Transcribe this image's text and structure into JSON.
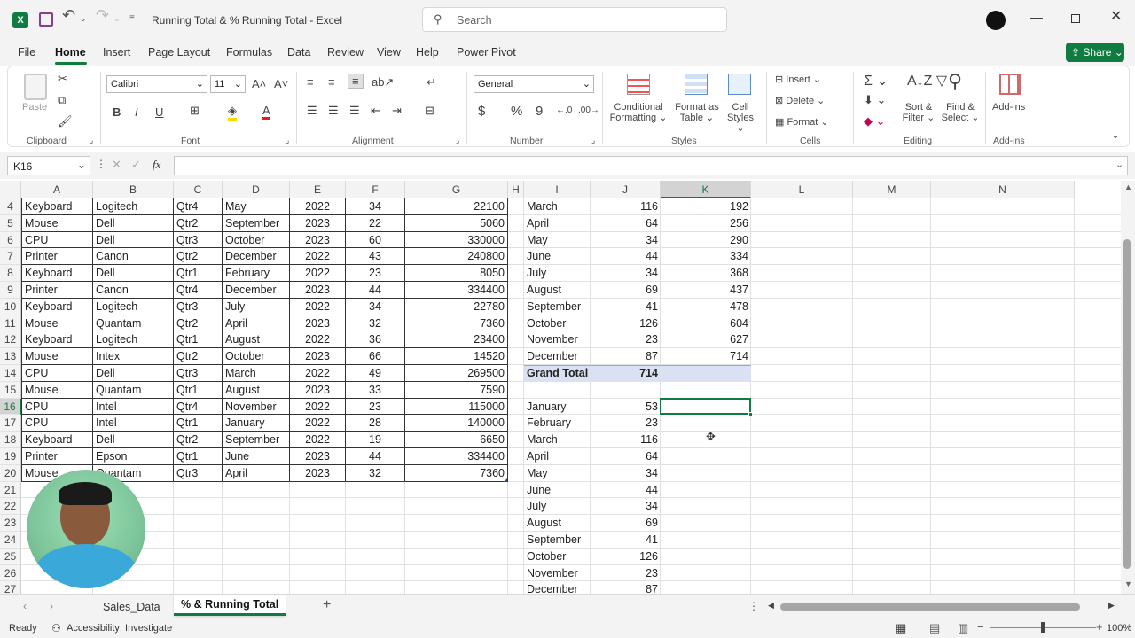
{
  "window": {
    "title": "Running Total & % Running Total  -  Excel",
    "search_placeholder": "Search"
  },
  "menu": {
    "tabs": [
      "File",
      "Home",
      "Insert",
      "Page Layout",
      "Formulas",
      "Data",
      "Review",
      "View",
      "Help",
      "Power Pivot"
    ],
    "share_label": "Share"
  },
  "ribbon": {
    "clipboard": {
      "paste": "Paste",
      "label": "Clipboard"
    },
    "font": {
      "name": "Calibri",
      "size": "11",
      "label": "Font",
      "bold": "B",
      "italic": "I",
      "underline": "U",
      "grow": "A˄",
      "shrink": "A˅",
      "font_color_letter": "A"
    },
    "alignment": {
      "label": "Alignment"
    },
    "number": {
      "format": "General",
      "label": "Number",
      "currency": "$",
      "percent": "%",
      "comma": "9"
    },
    "styles": {
      "conditional": [
        "Conditional",
        "Formatting"
      ],
      "format_table": [
        "Format as",
        "Table"
      ],
      "cell_styles": [
        "Cell",
        "Styles"
      ],
      "label": "Styles"
    },
    "cells": {
      "insert": "Insert",
      "delete": "Delete",
      "format": "Format",
      "label": "Cells"
    },
    "editing": {
      "sort": [
        "Sort &",
        "Filter"
      ],
      "find": [
        "Find &",
        "Select"
      ],
      "label": "Editing"
    },
    "addins": {
      "button": "Add-ins",
      "label": "Add-ins"
    }
  },
  "formula_bar": {
    "name_box": "K16",
    "fx": "fx",
    "value": ""
  },
  "columns": [
    "A",
    "B",
    "C",
    "D",
    "E",
    "F",
    "G",
    "H",
    "I",
    "J",
    "K",
    "L",
    "M",
    "N"
  ],
  "rows_left": [
    {
      "n": "4",
      "a": "Keyboard",
      "b": "Logitech",
      "c": "Qtr4",
      "d": "May",
      "e": "2022",
      "f": "34",
      "g": "22100"
    },
    {
      "n": "5",
      "a": "Mouse",
      "b": "Dell",
      "c": "Qtr2",
      "d": "September",
      "e": "2023",
      "f": "22",
      "g": "5060"
    },
    {
      "n": "6",
      "a": "CPU",
      "b": "Dell",
      "c": "Qtr3",
      "d": "October",
      "e": "2023",
      "f": "60",
      "g": "330000"
    },
    {
      "n": "7",
      "a": "Printer",
      "b": "Canon",
      "c": "Qtr2",
      "d": "December",
      "e": "2022",
      "f": "43",
      "g": "240800"
    },
    {
      "n": "8",
      "a": "Keyboard",
      "b": "Dell",
      "c": "Qtr1",
      "d": "February",
      "e": "2022",
      "f": "23",
      "g": "8050"
    },
    {
      "n": "9",
      "a": "Printer",
      "b": "Canon",
      "c": "Qtr4",
      "d": "December",
      "e": "2023",
      "f": "44",
      "g": "334400"
    },
    {
      "n": "10",
      "a": "Keyboard",
      "b": "Logitech",
      "c": "Qtr3",
      "d": "July",
      "e": "2022",
      "f": "34",
      "g": "22780"
    },
    {
      "n": "11",
      "a": "Mouse",
      "b": "Quantam",
      "c": "Qtr2",
      "d": "April",
      "e": "2023",
      "f": "32",
      "g": "7360"
    },
    {
      "n": "12",
      "a": "Keyboard",
      "b": "Logitech",
      "c": "Qtr1",
      "d": "August",
      "e": "2022",
      "f": "36",
      "g": "23400"
    },
    {
      "n": "13",
      "a": "Mouse",
      "b": "Intex",
      "c": "Qtr2",
      "d": "October",
      "e": "2023",
      "f": "66",
      "g": "14520"
    },
    {
      "n": "14",
      "a": "CPU",
      "b": "Dell",
      "c": "Qtr3",
      "d": "March",
      "e": "2022",
      "f": "49",
      "g": "269500"
    },
    {
      "n": "15",
      "a": "Mouse",
      "b": "Quantam",
      "c": "Qtr1",
      "d": "August",
      "e": "2023",
      "f": "33",
      "g": "7590"
    },
    {
      "n": "16",
      "a": "CPU",
      "b": "Intel",
      "c": "Qtr4",
      "d": "November",
      "e": "2022",
      "f": "23",
      "g": "115000"
    },
    {
      "n": "17",
      "a": "CPU",
      "b": "Intel",
      "c": "Qtr1",
      "d": "January",
      "e": "2022",
      "f": "28",
      "g": "140000"
    },
    {
      "n": "18",
      "a": "Keyboard",
      "b": "Dell",
      "c": "Qtr2",
      "d": "September",
      "e": "2022",
      "f": "19",
      "g": "6650"
    },
    {
      "n": "19",
      "a": "Printer",
      "b": "Epson",
      "c": "Qtr1",
      "d": "June",
      "e": "2023",
      "f": "44",
      "g": "334400"
    },
    {
      "n": "20",
      "a": "Mouse",
      "b": "Quantam",
      "c": "Qtr3",
      "d": "April",
      "e": "2023",
      "f": "32",
      "g": "7360"
    },
    {
      "n": "21"
    },
    {
      "n": "22"
    },
    {
      "n": "23"
    },
    {
      "n": "24"
    },
    {
      "n": "25"
    },
    {
      "n": "26"
    },
    {
      "n": "27"
    }
  ],
  "pivot_top": [
    {
      "i": "March",
      "j": "116",
      "k": "192"
    },
    {
      "i": "April",
      "j": "64",
      "k": "256"
    },
    {
      "i": "May",
      "j": "34",
      "k": "290"
    },
    {
      "i": "June",
      "j": "44",
      "k": "334"
    },
    {
      "i": "July",
      "j": "34",
      "k": "368"
    },
    {
      "i": "August",
      "j": "69",
      "k": "437"
    },
    {
      "i": "September",
      "j": "41",
      "k": "478"
    },
    {
      "i": "October",
      "j": "126",
      "k": "604"
    },
    {
      "i": "November",
      "j": "23",
      "k": "627"
    },
    {
      "i": "December",
      "j": "87",
      "k": "714"
    }
  ],
  "grand_total": {
    "label": "Grand Total",
    "value": "714"
  },
  "pivot_bottom": [
    {
      "i": "January",
      "j": "53"
    },
    {
      "i": "February",
      "j": "23"
    },
    {
      "i": "March",
      "j": "116"
    },
    {
      "i": "April",
      "j": "64"
    },
    {
      "i": "May",
      "j": "34"
    },
    {
      "i": "June",
      "j": "44"
    },
    {
      "i": "July",
      "j": "34"
    },
    {
      "i": "August",
      "j": "69"
    },
    {
      "i": "September",
      "j": "41"
    },
    {
      "i": "October",
      "j": "126"
    },
    {
      "i": "November",
      "j": "23"
    },
    {
      "i": "December",
      "j": "87"
    }
  ],
  "sheets": [
    "Sales_Data",
    "% & Running Total"
  ],
  "active_sheet": "% & Running Total",
  "status": {
    "ready": "Ready",
    "accessibility": "Accessibility: Investigate",
    "zoom": "100%"
  },
  "colors": {
    "accent": "#217346",
    "selection": "#107c41",
    "pivot_total_bg": "#d9e1f2"
  }
}
